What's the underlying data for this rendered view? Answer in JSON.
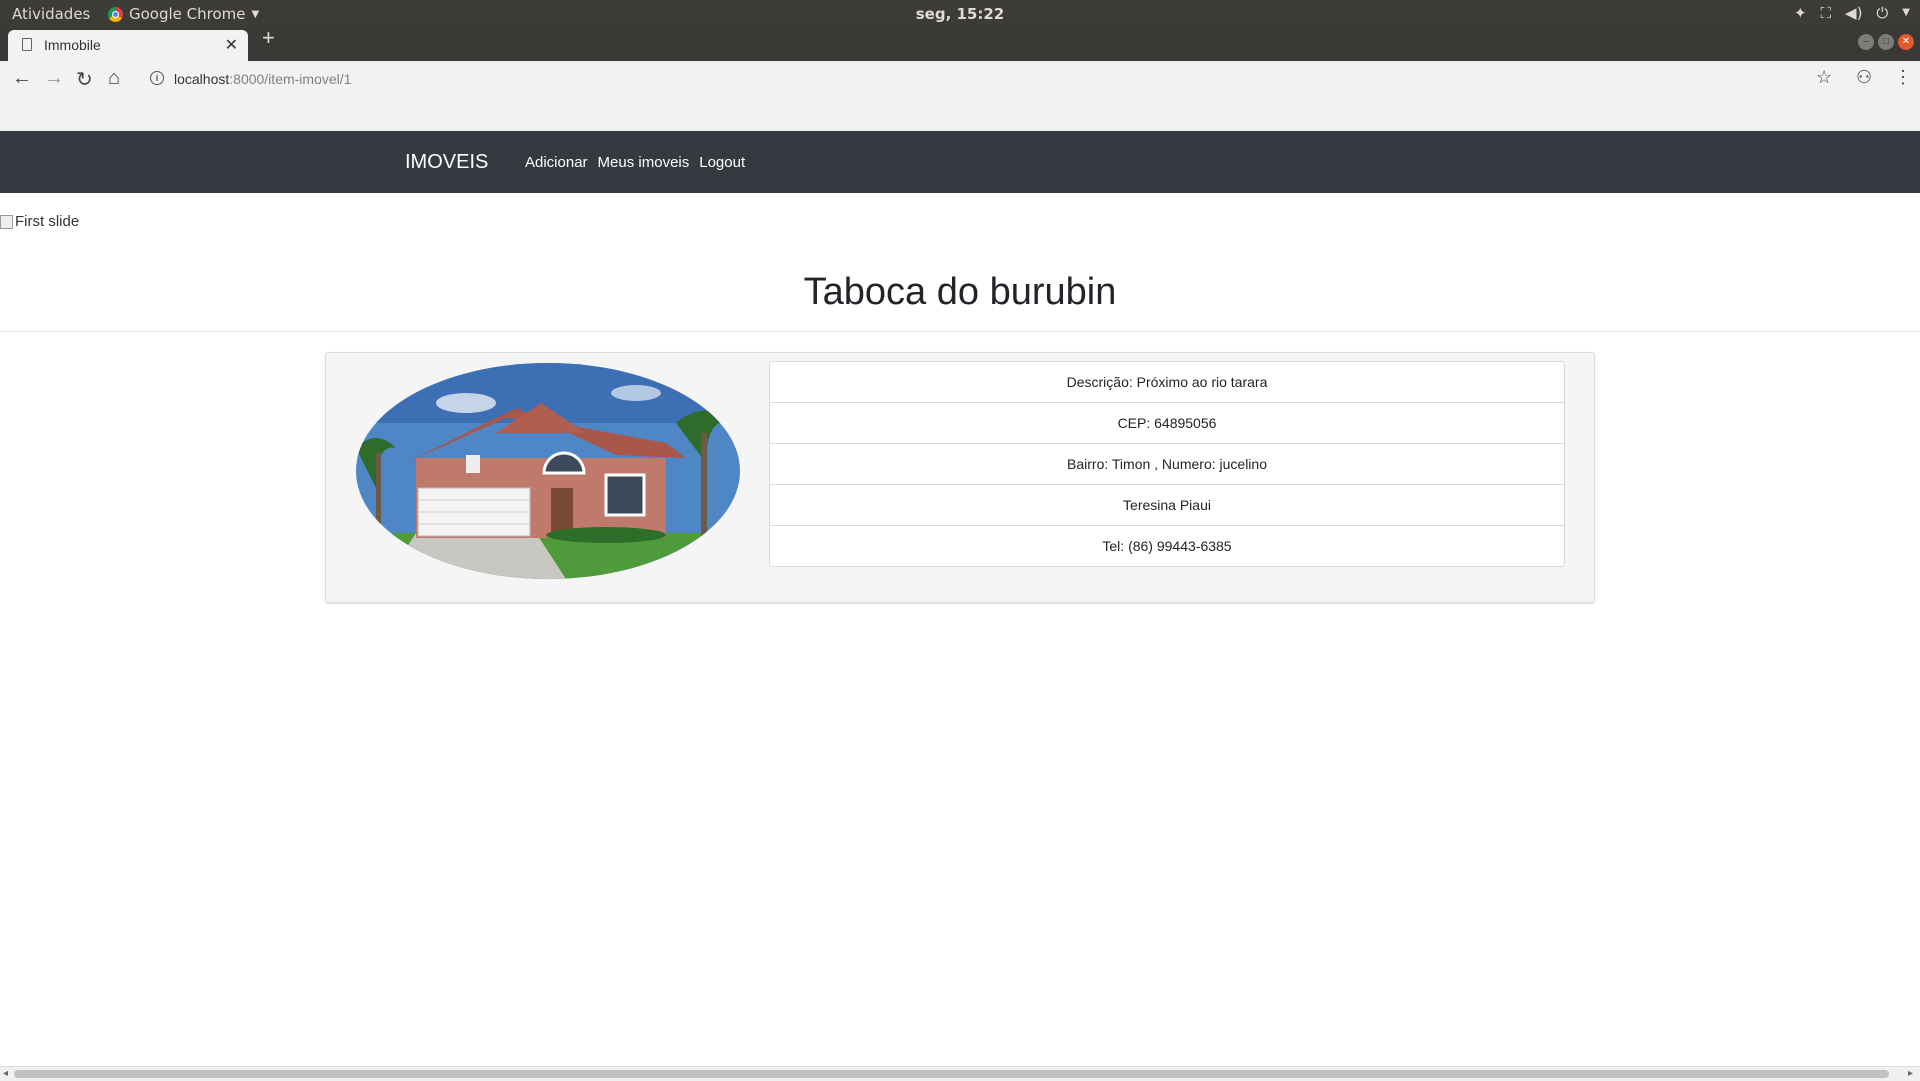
{
  "system_bar": {
    "activities": "Atividades",
    "app_name": "Google Chrome",
    "clock": "seg, 15:22"
  },
  "browser": {
    "tab_title": "Immobile",
    "url_host": "localhost",
    "url_rest": ":8000/item-imovel/1"
  },
  "navbar": {
    "brand": "IMOVEIS",
    "links": [
      "Adicionar",
      "Meus imoveis",
      "Logout"
    ]
  },
  "carousel": {
    "broken_image_alt": "First slide"
  },
  "property": {
    "title": "Taboca do burubin",
    "details": [
      "Descrição: Próximo ao rio tarara",
      "CEP: 64895056",
      "Bairro: Timon , Numero: jucelino",
      "Teresina Piaui",
      "Tel: (86) 99443-6385"
    ]
  },
  "colors": {
    "navbar_bg": "#343a40",
    "card_bg": "#f5f5f5",
    "text": "#212529"
  }
}
